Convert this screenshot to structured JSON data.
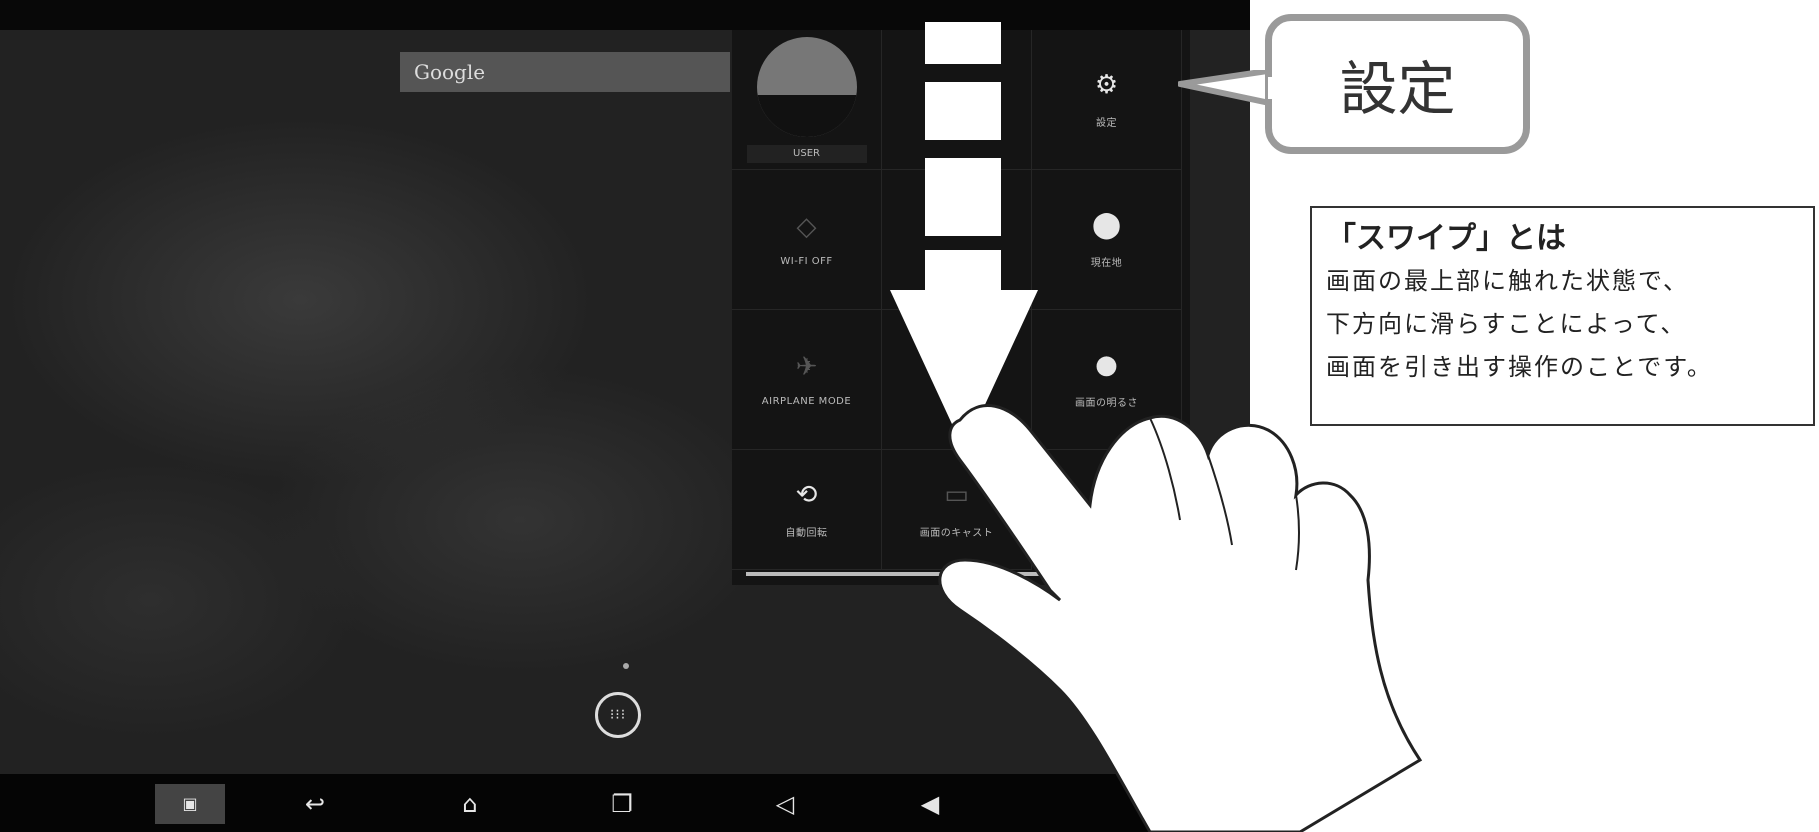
{
  "screen": {
    "search_widget_label": "Google"
  },
  "quick_settings": {
    "user_label": "USER",
    "tiles": [
      {
        "icon": "settings-icon",
        "glyph": "⚙",
        "label": "設定"
      },
      {
        "icon": "wifi-icon",
        "glyph": "◇",
        "label": "WI-FI OFF"
      },
      {
        "icon": "location-icon",
        "glyph": "⬤",
        "label": "現在地"
      },
      {
        "icon": "airplane-icon",
        "glyph": "✈",
        "label": "AIRPLANE MODE"
      },
      {
        "icon": "brightness-icon",
        "glyph": "●",
        "label": "画面の明るさ"
      },
      {
        "icon": "rotate-icon",
        "glyph": "⟲",
        "label": "自動回転"
      },
      {
        "icon": "cast-icon",
        "glyph": "▭",
        "label": "画面のキャスト"
      }
    ]
  },
  "navbar": {
    "buttons": [
      {
        "name": "screenshot",
        "glyph": "▣"
      },
      {
        "name": "back",
        "glyph": "↩"
      },
      {
        "name": "home",
        "glyph": "⌂"
      },
      {
        "name": "recents",
        "glyph": "❐"
      },
      {
        "name": "volume-down",
        "glyph": "◁"
      },
      {
        "name": "volume-up",
        "glyph": "◀"
      }
    ]
  },
  "callout": {
    "text": "設定"
  },
  "swipe_box": {
    "title": "「スワイプ」とは",
    "lines": [
      "画面の最上部に触れた状態で、",
      "下方向に滑らすことによって、",
      "画面を引き出す操作のことです。"
    ]
  },
  "colors": {
    "screen_bg": "#222222",
    "panel_bg": "#141414",
    "callout_border": "#9a9a9a"
  }
}
